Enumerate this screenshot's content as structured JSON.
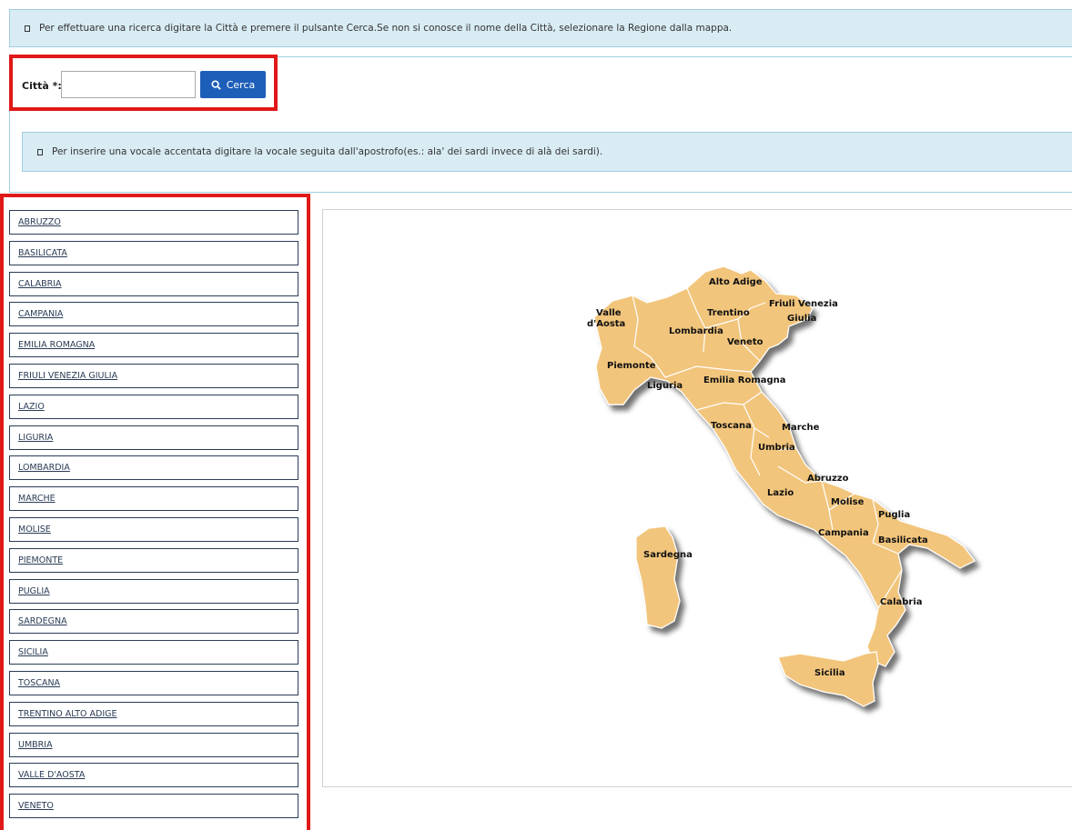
{
  "info_top": {
    "icon": "info-icon",
    "text": "Per effettuare una ricerca digitare la Città e premere il pulsante Cerca.Se non si conosce il nome della Città, selezionare la Regione dalla mappa."
  },
  "search": {
    "label": "Città *:",
    "value": "",
    "placeholder": "",
    "button_label": "Cerca",
    "button_icon": "search-icon",
    "button_color": "#1d5fb8"
  },
  "info_accent": {
    "icon": "info-icon",
    "text": "Per inserire una vocale accentata digitare la vocale seguita dall'apostrofo(es.: ala' dei sardi invece di alà dei sardi)."
  },
  "regions": [
    "ABRUZZO",
    "BASILICATA",
    "CALABRIA",
    "CAMPANIA",
    "EMILIA ROMAGNA",
    "FRIULI VENEZIA GIULIA",
    "LAZIO",
    "LIGURIA",
    "LOMBARDIA",
    "MARCHE",
    "MOLISE",
    "PIEMONTE",
    "PUGLIA",
    "SARDEGNA",
    "SICILIA",
    "TOSCANA",
    "TRENTINO ALTO ADIGE",
    "UMBRIA",
    "VALLE D'AOSTA",
    "VENETO"
  ],
  "map": {
    "fill_color": "#f2c57c",
    "labels": {
      "alto_adige": "Alto Adige",
      "friuli_1": "Friuli Venezia",
      "friuli_2": "Giulia",
      "valle_1": "Valle",
      "valle_2": "d'Aosta",
      "trentino": "Trentino",
      "lombardia": "Lombardia",
      "veneto": "Veneto",
      "piemonte": "Piemonte",
      "emilia": "Emilia Romagna",
      "liguria": "Liguria",
      "toscana": "Toscana",
      "marche": "Marche",
      "umbria": "Umbria",
      "abruzzo": "Abruzzo",
      "lazio": "Lazio",
      "molise": "Molise",
      "puglia": "Puglia",
      "campania": "Campania",
      "basilicata": "Basilicata",
      "sardegna": "Sardegna",
      "calabria": "Calabria",
      "sicilia": "Sicilia"
    }
  },
  "highlight_color": "#e01919"
}
